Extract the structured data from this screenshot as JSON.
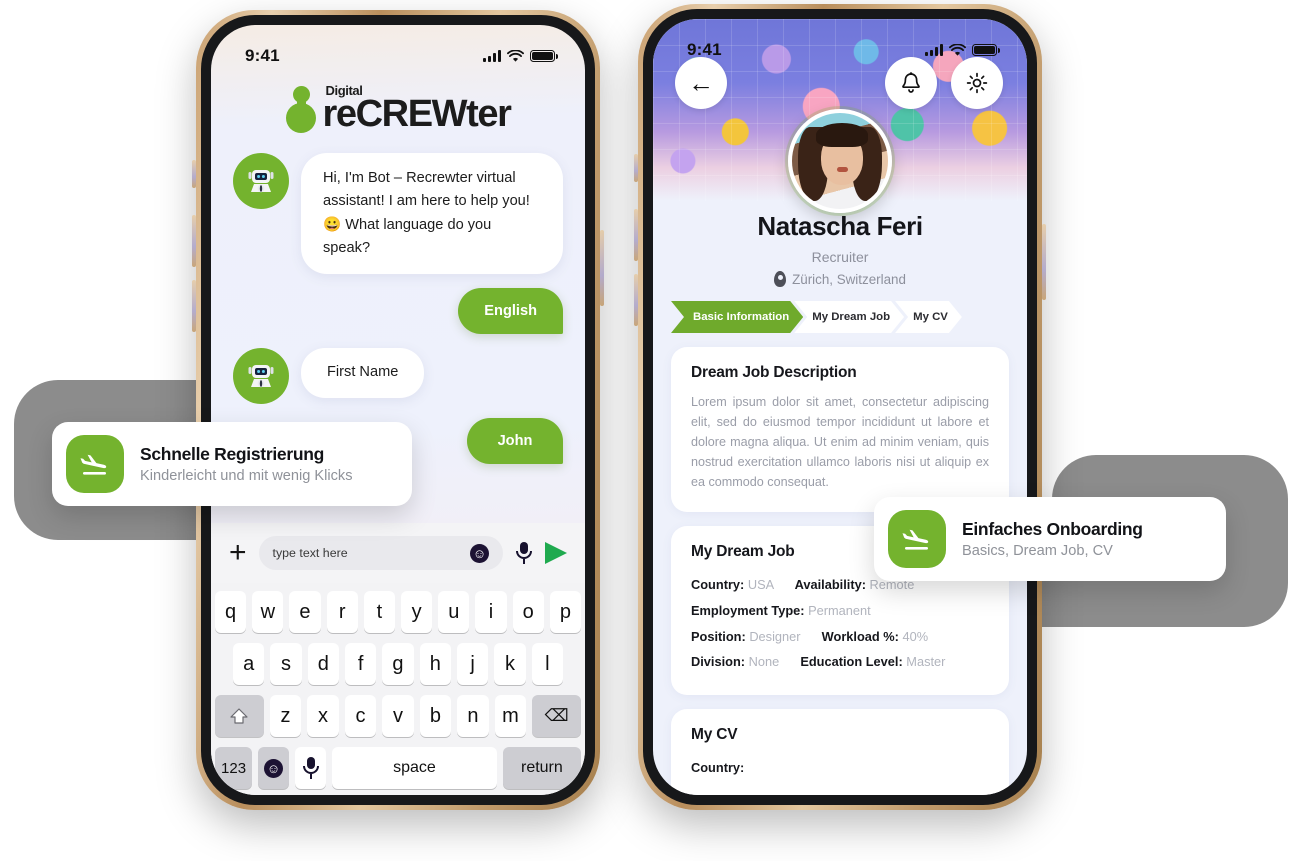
{
  "left_phone": {
    "status": {
      "time": "9:41",
      "signal_icon": "cellular-bars-icon",
      "wifi_icon": "wifi-icon",
      "battery_icon": "battery-full-icon"
    },
    "logo": {
      "small": "Digital",
      "big": "reCREWter",
      "mark": "green-node-logo-icon"
    },
    "chat": [
      {
        "from": "bot",
        "avatar": "robot-avatar-icon",
        "text": "Hi, I'm Bot – Recrewter virtual assistant! I am here to help you!😀 What language do you speak?"
      },
      {
        "from": "user",
        "text": "English"
      },
      {
        "from": "bot",
        "avatar": "robot-avatar-icon",
        "text": "First Name"
      },
      {
        "from": "user",
        "text": "John"
      }
    ],
    "input_bar": {
      "plus_label": "+",
      "placeholder": "type text here",
      "emoji_icon": "emoji-smiley-icon",
      "mic_icon": "microphone-icon",
      "send_icon": "send-arrow-icon"
    },
    "keyboard": {
      "row1": [
        "q",
        "w",
        "e",
        "r",
        "t",
        "y",
        "u",
        "i",
        "o",
        "p"
      ],
      "row2": [
        "a",
        "s",
        "d",
        "f",
        "g",
        "h",
        "j",
        "k",
        "l"
      ],
      "row3": [
        "z",
        "x",
        "c",
        "v",
        "b",
        "n",
        "m"
      ],
      "shift_icon": "shift-arrow-icon",
      "delete_icon": "⌫",
      "numbers_label": "123",
      "emoji_icon": "emoji-smiley-icon",
      "mic_icon": "microphone-icon",
      "space_label": "space",
      "return_label": "return"
    }
  },
  "right_phone": {
    "status": {
      "time": "9:41",
      "signal_icon": "cellular-bars-icon",
      "wifi_icon": "wifi-icon",
      "battery_icon": "battery-full-icon"
    },
    "header": {
      "back_icon": "back-arrow-icon",
      "bell_icon": "notification-bell-icon",
      "gear_icon": "settings-gear-icon",
      "banner_art": "colorful-doodle-illustration",
      "avatar": "user-profile-photo"
    },
    "profile": {
      "name": "Natascha Feri",
      "role": "Recruiter",
      "location": "Zürich, Switzerland",
      "location_icon": "map-pin-icon"
    },
    "tabs": [
      {
        "label": "Basic Information",
        "active": true
      },
      {
        "label": "My Dream Job",
        "active": false
      },
      {
        "label": "My CV",
        "active": false
      }
    ],
    "cards": {
      "description": {
        "title": "Dream Job Description",
        "body": "Lorem ipsum dolor sit amet, consectetur adipiscing elit, sed do eiusmod tempor incididunt ut labore et dolore magna aliqua. Ut enim ad minim veniam, quis nostrud exercitation ullamco laboris nisi ut aliquip ex ea commodo consequat."
      },
      "dream_job": {
        "title": "My Dream Job",
        "fields": [
          {
            "key": "Country:",
            "value": "USA"
          },
          {
            "key": "Availability:",
            "value": "Remote"
          },
          {
            "key": "Employment Type:",
            "value": "Permanent"
          },
          {
            "key": "Position:",
            "value": "Designer"
          },
          {
            "key": "Workload %:",
            "value": "40%"
          },
          {
            "key": "Division:",
            "value": "None"
          },
          {
            "key": "Education Level:",
            "value": "Master"
          }
        ]
      },
      "cv": {
        "title": "My CV",
        "field_key": "Country:"
      }
    }
  },
  "callouts": [
    {
      "icon": "airplane-takeoff-icon",
      "title": "Schnelle Registrierung",
      "subtitle": "Kinderleicht und mit wenig Klicks"
    },
    {
      "icon": "airplane-takeoff-icon",
      "title": "Einfaches Onboarding",
      "subtitle": "Basics, Dream Job, CV"
    }
  ],
  "colors": {
    "brand_green": "#74b32e",
    "tab_green": "#6faa2c",
    "send_green": "#1faa4f",
    "slab_grey": "#8c8c8c"
  }
}
